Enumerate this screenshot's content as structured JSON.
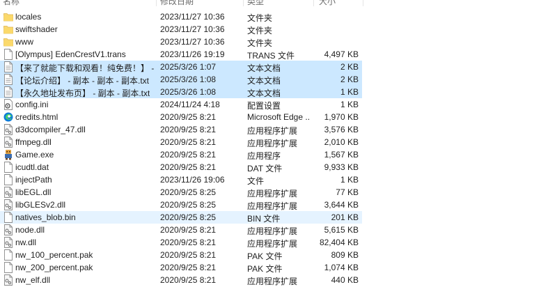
{
  "header": {
    "name": "名称",
    "date": "修改日期",
    "type": "类型",
    "size": "大小"
  },
  "files": [
    {
      "name": "locales",
      "date": "2023/11/27 10:36",
      "type": "文件夹",
      "size": "",
      "icon": "folder-icon"
    },
    {
      "name": "swiftshader",
      "date": "2023/11/27 10:36",
      "type": "文件夹",
      "size": "",
      "icon": "folder-icon"
    },
    {
      "name": "www",
      "date": "2023/11/27 10:36",
      "type": "文件夹",
      "size": "",
      "icon": "folder-icon"
    },
    {
      "name": "[Olympus] EdenCrestV1.trans",
      "date": "2023/11/26 19:19",
      "type": "TRANS 文件",
      "size": "4,497 KB",
      "icon": "file-icon"
    },
    {
      "name": "【来了就能下载和观看！纯免费！】 - 副...",
      "date": "2025/3/26 1:07",
      "type": "文本文档",
      "size": "2 KB",
      "icon": "text-file-icon",
      "state": "selected"
    },
    {
      "name": "【论坛介绍】 - 副本 - 副本 - 副本.txt",
      "date": "2025/3/26 1:08",
      "type": "文本文档",
      "size": "2 KB",
      "icon": "text-file-icon",
      "state": "selected"
    },
    {
      "name": "【永久地址发布页】 - 副本 - 副本.txt",
      "date": "2025/3/26 1:08",
      "type": "文本文档",
      "size": "1 KB",
      "icon": "text-file-icon",
      "state": "selected"
    },
    {
      "name": "config.ini",
      "date": "2024/11/24 4:18",
      "type": "配置设置",
      "size": "1 KB",
      "icon": "settings-file-icon"
    },
    {
      "name": "credits.html",
      "date": "2020/9/25 8:21",
      "type": "Microsoft Edge ...",
      "size": "1,970 KB",
      "icon": "edge-icon"
    },
    {
      "name": "d3dcompiler_47.dll",
      "date": "2020/9/25 8:21",
      "type": "应用程序扩展",
      "size": "3,576 KB",
      "icon": "dll-icon"
    },
    {
      "name": "ffmpeg.dll",
      "date": "2020/9/25 8:21",
      "type": "应用程序扩展",
      "size": "2,010 KB",
      "icon": "dll-icon"
    },
    {
      "name": "Game.exe",
      "date": "2020/9/25 8:21",
      "type": "应用程序",
      "size": "1,567 KB",
      "icon": "game-exe-icon"
    },
    {
      "name": "icudtl.dat",
      "date": "2020/9/25 8:21",
      "type": "DAT 文件",
      "size": "9,933 KB",
      "icon": "file-icon"
    },
    {
      "name": "injectPath",
      "date": "2023/11/26 19:06",
      "type": "文件",
      "size": "1 KB",
      "icon": "file-icon"
    },
    {
      "name": "libEGL.dll",
      "date": "2020/9/25 8:25",
      "type": "应用程序扩展",
      "size": "77 KB",
      "icon": "dll-icon"
    },
    {
      "name": "libGLESv2.dll",
      "date": "2020/9/25 8:25",
      "type": "应用程序扩展",
      "size": "3,644 KB",
      "icon": "dll-icon"
    },
    {
      "name": "natives_blob.bin",
      "date": "2020/9/25 8:25",
      "type": "BIN 文件",
      "size": "201 KB",
      "icon": "file-icon",
      "state": "hover"
    },
    {
      "name": "node.dll",
      "date": "2020/9/25 8:21",
      "type": "应用程序扩展",
      "size": "5,615 KB",
      "icon": "dll-icon"
    },
    {
      "name": "nw.dll",
      "date": "2020/9/25 8:21",
      "type": "应用程序扩展",
      "size": "82,404 KB",
      "icon": "dll-icon"
    },
    {
      "name": "nw_100_percent.pak",
      "date": "2020/9/25 8:21",
      "type": "PAK 文件",
      "size": "809 KB",
      "icon": "file-icon"
    },
    {
      "name": "nw_200_percent.pak",
      "date": "2020/9/25 8:21",
      "type": "PAK 文件",
      "size": "1,074 KB",
      "icon": "file-icon"
    },
    {
      "name": "nw_elf.dll",
      "date": "2020/9/25 8:21",
      "type": "应用程序扩展",
      "size": "440 KB",
      "icon": "dll-icon"
    }
  ],
  "colors": {
    "selected": "#cce8ff",
    "hover": "#e5f3ff",
    "folder": "#f8d775"
  }
}
